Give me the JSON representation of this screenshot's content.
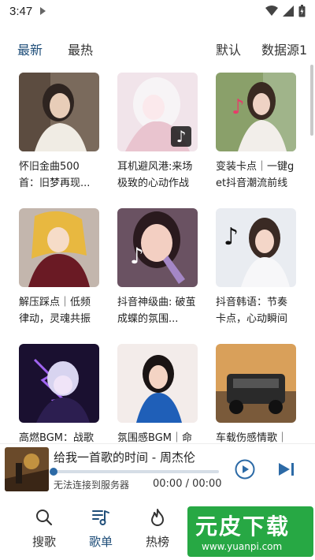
{
  "status_bar": {
    "time": "3:47"
  },
  "filters": {
    "latest": "最新",
    "hottest": "最热",
    "default": "默认",
    "source": "数据源1"
  },
  "playlists": [
    {
      "title": "怀旧金曲500首：旧梦再现..."
    },
    {
      "title": "耳机避风港:来场极致的心动作战"
    },
    {
      "title": "变装卡点｜一键get抖音潮流前线"
    },
    {
      "title": "解压踩点｜低频律动，灵魂共振"
    },
    {
      "title": "抖音神级曲: 破茧成蝶的氛围..."
    },
    {
      "title": "抖音韩语：节奏卡点，心动瞬间"
    },
    {
      "title": "高燃BGM：战歌"
    },
    {
      "title": "氛围感BGM｜命"
    },
    {
      "title": "车载伤感情歌｜"
    }
  ],
  "player": {
    "song": "给我一首歌的时间 - 周杰伦",
    "status": "无法连接到服务器",
    "time": "00:00 / 00:00",
    "progress": 0
  },
  "nav": {
    "search": "搜歌",
    "playlist": "歌单",
    "charts": "热榜"
  },
  "watermark": {
    "text": "元皮下载",
    "url": "www.yuanpi.com"
  },
  "colors": {
    "accent": "#1f4e79",
    "progress_knob": "#2c6aa6",
    "watermark_bg": "#27a844"
  }
}
